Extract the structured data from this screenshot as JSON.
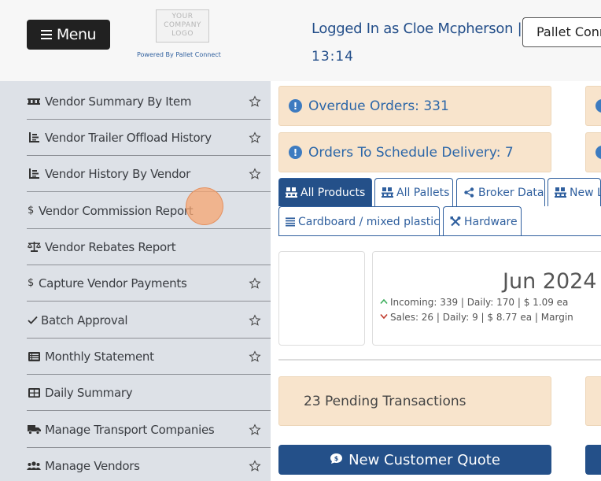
{
  "header": {
    "menu_label": "Menu",
    "logo_text": "YOUR COMPANY LOGO",
    "powered_by": "Powered By Pallet Connect",
    "logged_in": "Logged In as Cloe Mcpherson |",
    "time": "13:14",
    "company_button": "Pallet Connect"
  },
  "sidebar": {
    "items": [
      {
        "label": "Vendor Summary By Item",
        "icon": "pallet-icon",
        "starred": true
      },
      {
        "label": "Vendor Trailer Offload History",
        "icon": "chart-list-icon",
        "starred": true
      },
      {
        "label": "Vendor History By Vendor",
        "icon": "chart-list-icon",
        "starred": true
      },
      {
        "label": "Vendor Commission Report",
        "icon": "dollar-icon",
        "starred": false
      },
      {
        "label": "Vendor Rebates Report",
        "icon": "balance-scale-icon",
        "starred": false
      },
      {
        "label": "Capture Vendor Payments",
        "icon": "dollar-icon",
        "starred": true
      },
      {
        "label": "Batch Approval",
        "icon": "check-icon",
        "starred": true
      },
      {
        "label": "Monthly Statement",
        "icon": "statement-icon",
        "starred": true
      },
      {
        "label": "Daily Summary",
        "icon": "table-icon",
        "starred": false
      },
      {
        "label": "Manage Transport Companies",
        "icon": "truck-icon",
        "starred": true
      },
      {
        "label": "Manage Vendors",
        "icon": "users-icon",
        "starred": true
      }
    ]
  },
  "alerts": {
    "overdue": "Overdue Orders: 331",
    "to_schedule": "Orders To Schedule Delivery: 7"
  },
  "tabs": [
    {
      "label": "All Products",
      "active": true
    },
    {
      "label": "All Pallets",
      "active": false
    },
    {
      "label": "Broker Data",
      "active": false
    },
    {
      "label": "New L",
      "active": false
    },
    {
      "label": "Cardboard / mixed plastic",
      "active": false
    },
    {
      "label": "Hardware",
      "active": false
    }
  ],
  "summary": {
    "month": "Jun 2024",
    "incoming": "Incoming: 339 | Daily: 170 | $ 1.09 ea",
    "sales": "Sales: 26 | Daily: 9 | $ 8.77 ea | Margin"
  },
  "pending": "23 Pending Transactions",
  "quote_button": "New Customer Quote",
  "colors": {
    "accent": "#245089",
    "alert_bg": "#f8e4cc",
    "sidebar_bg": "#dde1e7"
  }
}
